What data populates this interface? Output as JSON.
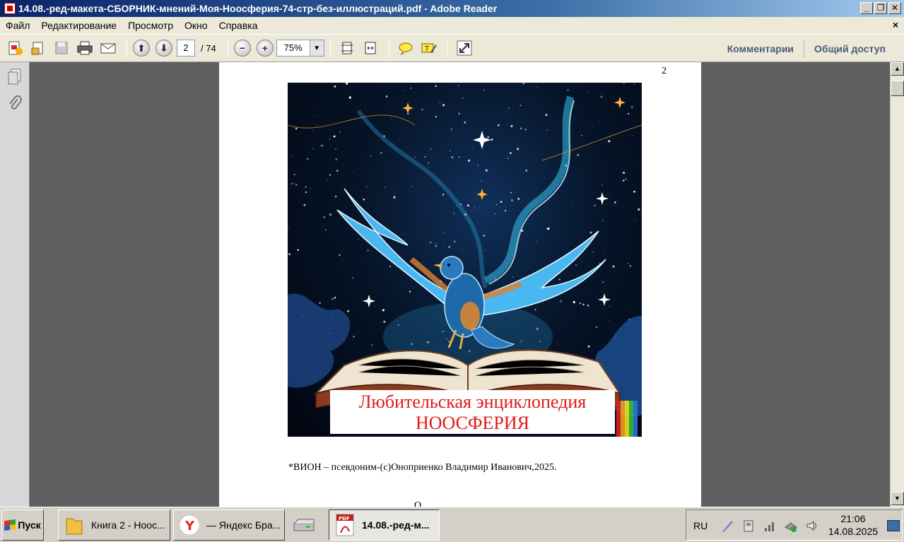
{
  "window": {
    "title": "14.08.-ред-макета-СБОРНИК-мнений-Моя-Ноосферия-74-стр-без-иллюстраций.pdf - Adobe Reader",
    "minimize": "_",
    "restore": "❐",
    "close": "✕"
  },
  "menu": {
    "items": [
      "Файл",
      "Редактирование",
      "Просмотр",
      "Окно",
      "Справка"
    ],
    "close_doc": "×"
  },
  "toolbar": {
    "page_current": "2",
    "page_total": "/ 74",
    "zoom": "75%",
    "comments": "Комментарии",
    "share": "Общий доступ"
  },
  "document": {
    "page_number": "2",
    "cover_line1": "Любительская энциклопедия",
    "cover_line2": "НООСФЕРИЯ",
    "footnote": "*ВИОН – псевдоним-(с)Оноприенко Владимир Иванович,2025.",
    "bottom_mark": "О"
  },
  "taskbar": {
    "start": "Пуск",
    "tasks": [
      "Книга 2 - Ноос...",
      "— Яндекс Бра...",
      "",
      "14.08.-ред-м..."
    ],
    "lang": "RU",
    "time": "21:06",
    "date": "14.08.2025"
  },
  "colors": {
    "title_bar": "#0a246a",
    "cover_caption": "#e01818",
    "doc_background": "#5f5f5f"
  }
}
